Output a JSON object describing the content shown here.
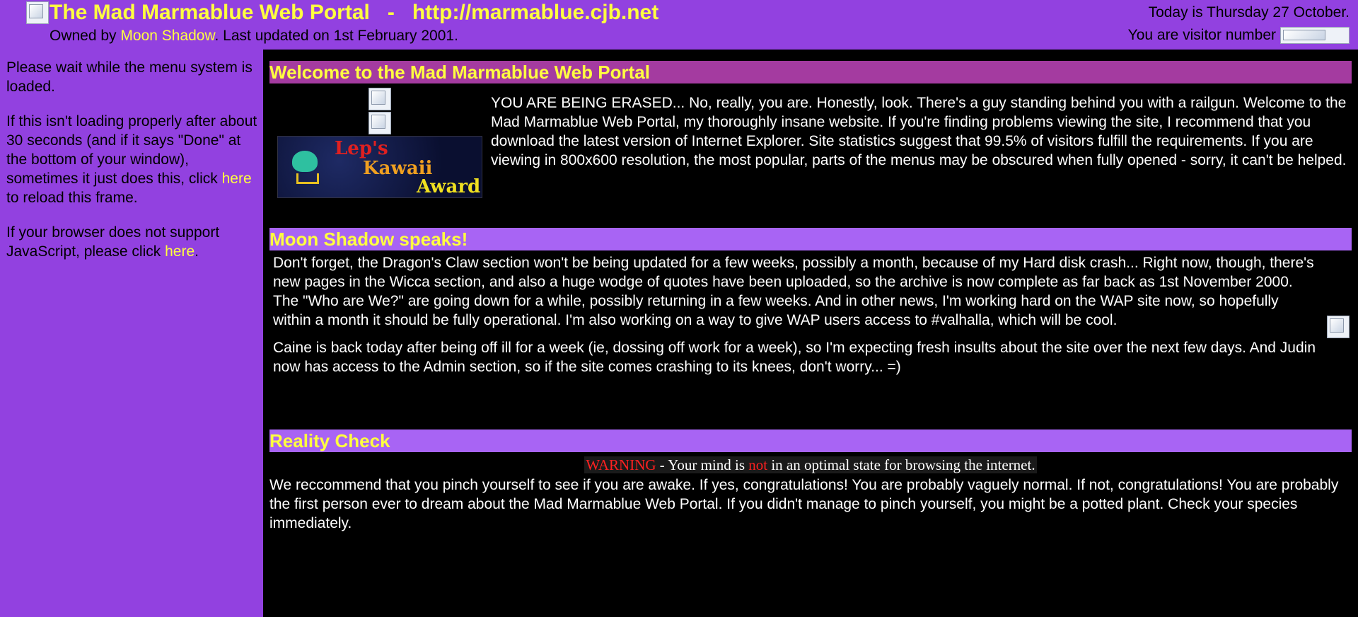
{
  "header": {
    "title": "The Mad Marmablue Web Portal   -   http://marmablue.cjb.net",
    "owned_by_prefix": "Owned by ",
    "owner_name": "Moon Shadow",
    "updated_text": ". Last updated on 1st February 2001.",
    "date_text": "Today is Thursday 27 October.",
    "visitor_text": "You are visitor number"
  },
  "sidebar": {
    "loading_text": "Please wait while the menu system is loaded.",
    "reload_prefix": "If this isn't loading properly after about 30 seconds (and if it says \"Done\" at the bottom of your window), sometimes it just does this, click ",
    "reload_link": "here",
    "reload_suffix": " to reload this frame.",
    "nojs_prefix": "If your browser does not support JavaScript, please click ",
    "nojs_link": "here",
    "nojs_suffix": "."
  },
  "welcome": {
    "heading": "Welcome to the Mad Marmablue Web Portal",
    "award_line1": "Lep's",
    "award_line2": "Kawaii",
    "award_line3": "Award",
    "body": "YOU ARE BEING ERASED... No, really, you are. Honestly, look. There's a guy standing behind you with a railgun. Welcome to the Mad Marmablue Web Portal, my thoroughly insane website. If you're finding problems viewing the site, I recommend that you download the latest version of Internet Explorer. Site statistics suggest that 99.5% of visitors fulfill the requirements. If you are viewing in 800x600 resolution, the most popular, parts of the menus may be obscured when fully opened - sorry, it can't be helped."
  },
  "moon": {
    "heading": "Moon Shadow speaks!",
    "para1": "Don't forget, the Dragon's Claw section won't be being updated for a few weeks, possibly a month, because of my Hard disk crash... Right now, though, there's new pages in the Wicca section, and also a huge wodge of quotes have been uploaded, so the archive is now complete as far back as 1st November 2000. The \"Who are We?\" are going down for a while, possibly returning in a few weeks. And in other news, I'm working hard on the WAP site now, so hopefully within a month it should be fully operational. I'm also working on a way to give WAP users access to #valhalla, which will be cool.",
    "para2": "Caine is back today after being off ill for a week (ie, dossing off work for a week), so I'm expecting fresh insults about the site over the next few days. And Judin now has access to the Admin section, so if the site comes crashing to its knees, don't worry... =)"
  },
  "reality": {
    "heading": "Reality Check",
    "warn_word": "WARNING",
    "warn_mid": " - Your mind is ",
    "warn_not": "not",
    "warn_end": " in an optimal state for browsing the internet.",
    "body": "We reccommend that you pinch yourself to see if you are awake. If yes, congratulations! You are probably vaguely normal. If not, congratulations! You are probably the first person ever to dream about the Mad Marmablue Web Portal. If you didn't manage to pinch yourself, you might be a potted plant. Check your species immediately."
  },
  "colors": {
    "page_bg": "#9241e0",
    "link": "#ffff40",
    "welcome_bar": "#a43ba0",
    "section_bar": "#a864f4",
    "warning_red": "#ff2020"
  }
}
